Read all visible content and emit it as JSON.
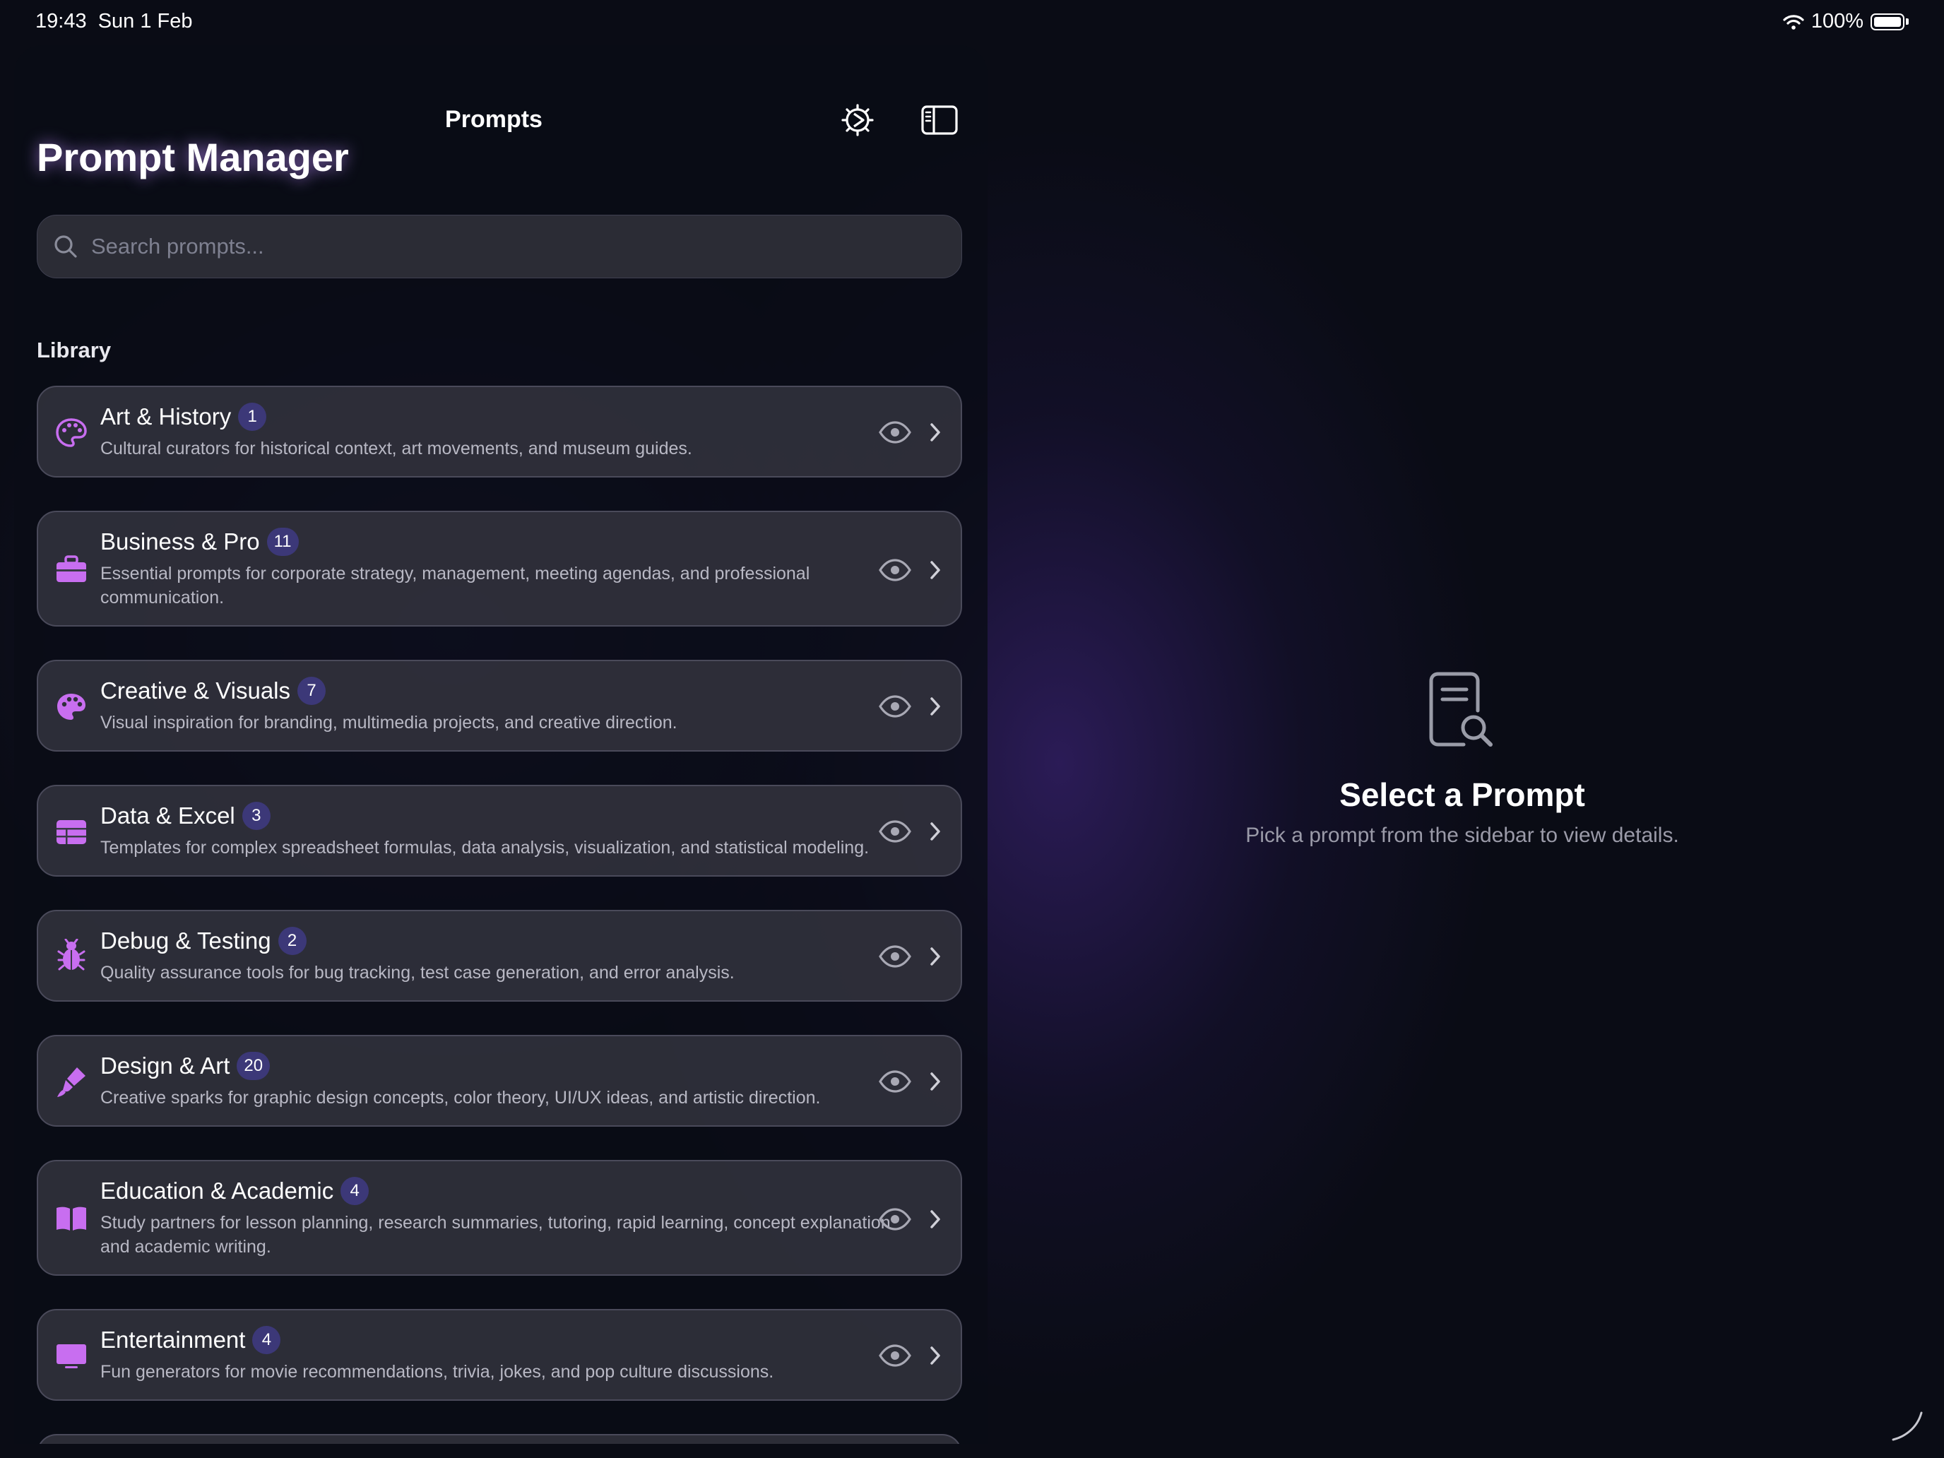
{
  "status_bar": {
    "time": "19:43",
    "date": "Sun 1 Feb",
    "battery": "100%",
    "wifi_icon": "wifi-icon",
    "battery_icon": "battery-icon"
  },
  "sidebar": {
    "nav_title": "Prompts",
    "settings_icon": "gear-icon",
    "toggle_icon": "sidebar-toggle-icon",
    "title": "Prompt Manager",
    "search_placeholder": "Search prompts...",
    "section_label": "Library",
    "categories": [
      {
        "title": "Art & History",
        "count": "1",
        "description": "Cultural curators for historical context, art movements, and museum guides.",
        "icon": "palette-icon"
      },
      {
        "title": "Business & Pro",
        "count": "11",
        "description": "Essential prompts for corporate strategy, management, meeting agendas, and professional communication.",
        "icon": "briefcase-icon"
      },
      {
        "title": "Creative & Visuals",
        "count": "7",
        "description": "Visual inspiration for branding, multimedia projects, and creative direction.",
        "icon": "palette-filled-icon"
      },
      {
        "title": "Data & Excel",
        "count": "3",
        "description": "Templates for complex spreadsheet formulas, data analysis, visualization, and statistical modeling.",
        "icon": "table-icon"
      },
      {
        "title": "Debug & Testing",
        "count": "2",
        "description": "Quality assurance tools for bug tracking, test case generation, and error analysis.",
        "icon": "ladybug-icon"
      },
      {
        "title": "Design & Art",
        "count": "20",
        "description": "Creative sparks for graphic design concepts, color theory, UI/UX ideas, and artistic direction.",
        "icon": "paintbrush-icon"
      },
      {
        "title": "Education & Academic",
        "count": "4",
        "description": "Study partners for lesson planning, research summaries, tutoring, rapid learning, concept explanation and academic writing.",
        "icon": "book-icon"
      },
      {
        "title": "Entertainment",
        "count": "4",
        "description": "Fun generators for movie recommendations, trivia, jokes, and pop culture discussions.",
        "icon": "tv-icon"
      }
    ],
    "accent_color": "#c86ef0",
    "badge_color": "#3c3878"
  },
  "detail": {
    "icon": "document-search-icon",
    "title": "Select a Prompt",
    "subtitle": "Pick a prompt from the sidebar to view details."
  }
}
